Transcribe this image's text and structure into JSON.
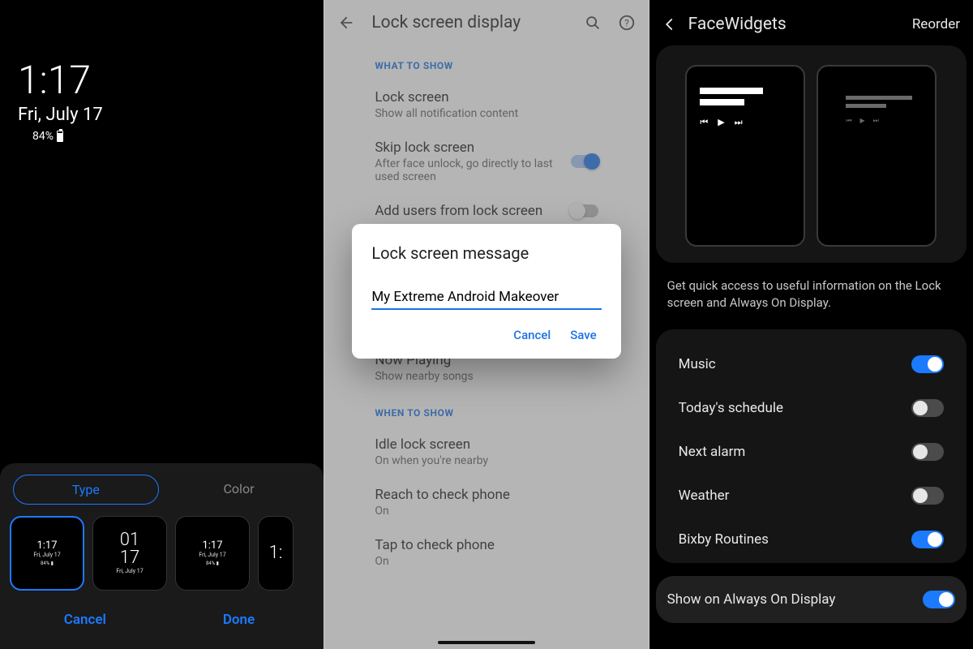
{
  "p1": {
    "time": "1:17",
    "date": "Fri, July 17",
    "battery": "84%",
    "segment": {
      "type": "Type",
      "color": "Color"
    },
    "thumbs": [
      {
        "time": "1:17",
        "date": "Fri, July 17",
        "batt": "84% ▮"
      },
      {
        "time_top": "01",
        "time_bot": "17",
        "date": "Fri, July 17"
      },
      {
        "time": "1:17",
        "date": "Fri, July 17",
        "batt": "84% ▮"
      },
      {
        "time": "1:"
      }
    ],
    "actions": {
      "cancel": "Cancel",
      "done": "Done"
    }
  },
  "p2": {
    "title": "Lock screen display",
    "section1_header": "WHAT TO SHOW",
    "rows": {
      "lock_screen": {
        "label": "Lock screen",
        "sub": "Show all notification content"
      },
      "skip_lock": {
        "label": "Skip lock screen",
        "sub": "After face unlock, go directly to last used screen"
      },
      "add_users": {
        "label": "Add users from lock screen"
      },
      "now_playing": {
        "label": "Now Playing",
        "sub": "Show nearby songs"
      }
    },
    "section2_header": "WHEN TO SHOW",
    "rows2": {
      "idle": {
        "label": "Idle lock screen",
        "sub": "On when you're nearby"
      },
      "reach": {
        "label": "Reach to check phone",
        "sub": "On"
      },
      "tap": {
        "label": "Tap to check phone",
        "sub": "On"
      }
    },
    "dialog": {
      "title": "Lock screen message",
      "value": "My Extreme Android Makeover",
      "cancel": "Cancel",
      "save": "Save"
    }
  },
  "p3": {
    "title": "FaceWidgets",
    "reorder": "Reorder",
    "description": "Get quick access to useful information on the Lock screen and Always On Display.",
    "items": [
      {
        "label": "Music",
        "on": true
      },
      {
        "label": "Today's schedule",
        "on": false
      },
      {
        "label": "Next alarm",
        "on": false
      },
      {
        "label": "Weather",
        "on": false
      },
      {
        "label": "Bixby Routines",
        "on": true
      }
    ],
    "aod": {
      "label": "Show on Always On Display",
      "on": true
    }
  }
}
